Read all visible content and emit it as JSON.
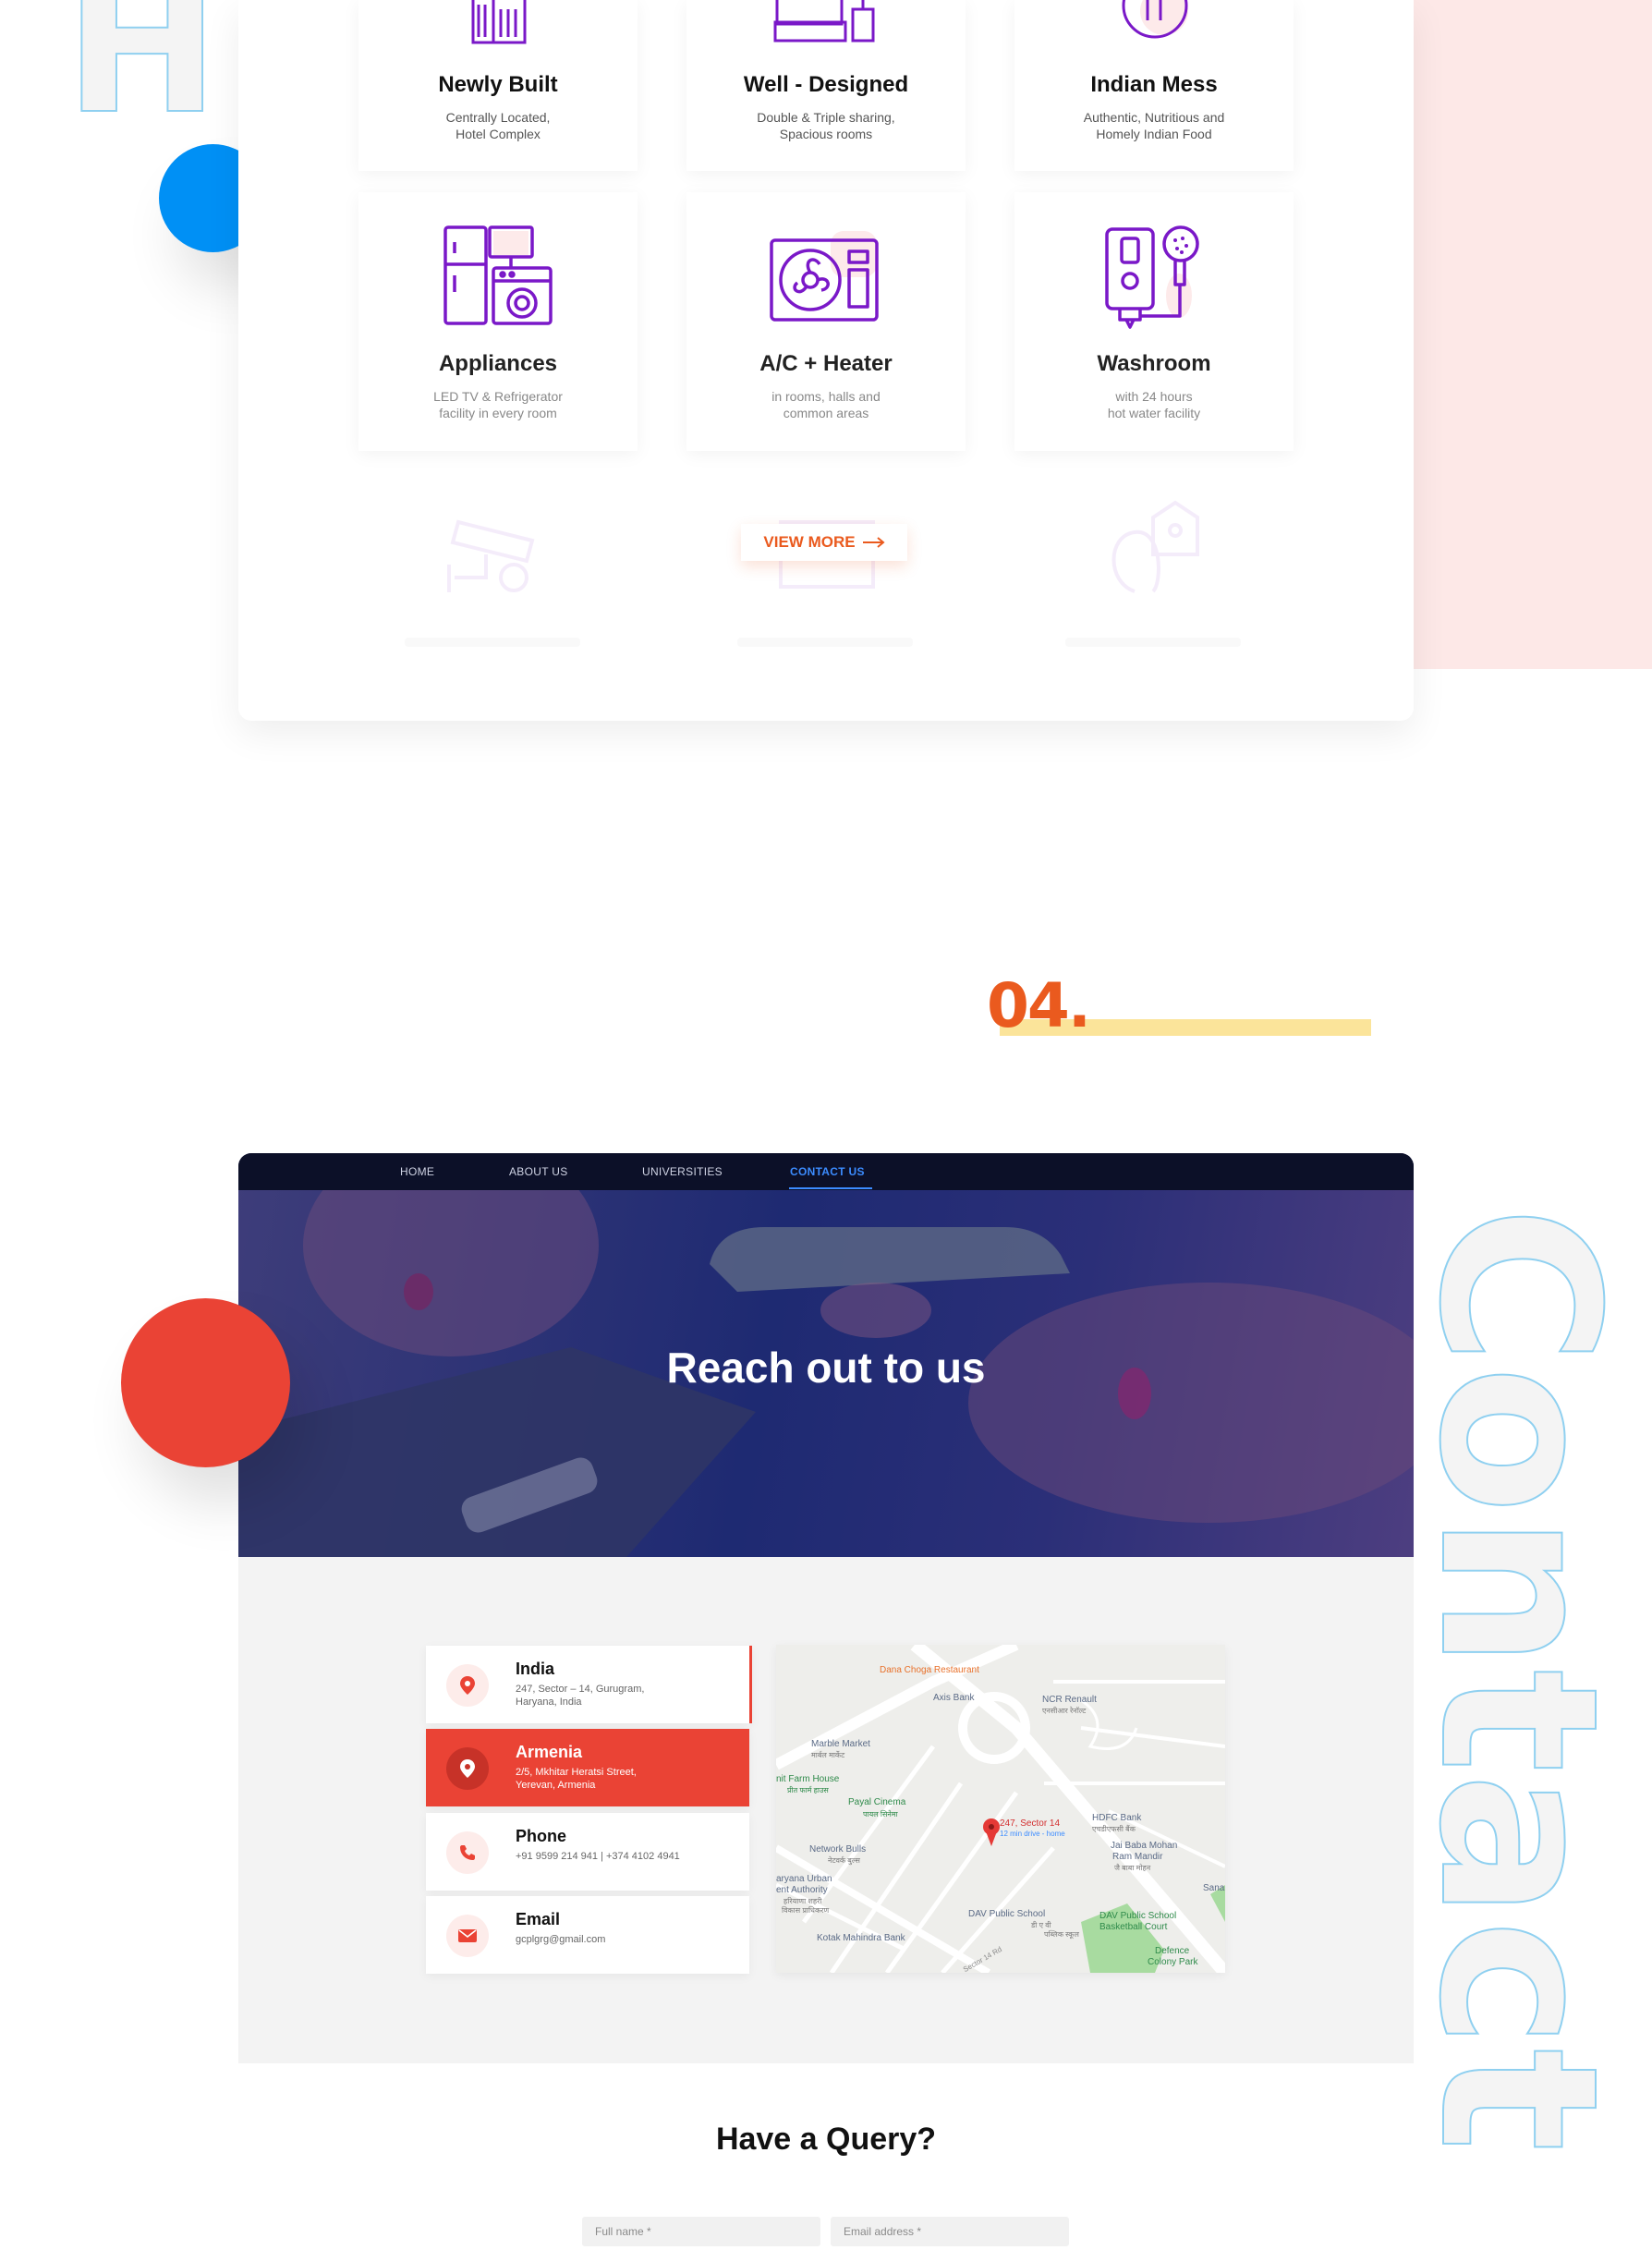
{
  "decor": {
    "letter_top": "H",
    "contact_word": [
      "C",
      "o",
      "n",
      "t",
      "a",
      "c",
      "t"
    ]
  },
  "amenities": [
    {
      "title": "Newly Built",
      "desc": "Centrally Located,\nHotel Complex",
      "icon": "building-icon"
    },
    {
      "title": "Well - Designed",
      "desc": "Double & Triple sharing,\nSpacious rooms",
      "icon": "bed-icon"
    },
    {
      "title": "Indian Mess",
      "desc": "Authentic, Nutritious and\nHomely Indian Food",
      "icon": "food-plate-icon"
    },
    {
      "title": "Appliances",
      "desc": "LED TV & Refrigerator\nfacility in every room",
      "icon": "appliances-icon"
    },
    {
      "title": "A/C + Heater",
      "desc": "in rooms, halls and\ncommon areas",
      "icon": "air-conditioner-icon"
    },
    {
      "title": "Washroom",
      "desc": "with 24 hours\nhot water facility",
      "icon": "water-heater-shower-icon"
    }
  ],
  "faded_icons": [
    "cctv-camera-icon",
    "bed-icon",
    "fingerprint-lock-icon"
  ],
  "view_more": {
    "label": "VIEW MORE"
  },
  "section_number": "04.",
  "nav": {
    "items": [
      "HOME",
      "ABOUT US",
      "UNIVERSITIES",
      "CONTACT US"
    ],
    "active": "CONTACT US"
  },
  "hero": {
    "title": "Reach out to us"
  },
  "contacts": [
    {
      "title": "India",
      "detail": "247, Sector – 14, Gurugram,\nHaryana, India",
      "icon": "location-pin-icon"
    },
    {
      "title": "Armenia",
      "detail": "2/5, Mkhitar Heratsi Street,\nYerevan, Armenia",
      "icon": "location-pin-icon"
    },
    {
      "title": "Phone",
      "detail": "+91 9599 214 941 | +374 4102 4941",
      "icon": "phone-icon"
    },
    {
      "title": "Email",
      "detail": "gcplgrg@gmail.com",
      "icon": "email-icon"
    }
  ],
  "map": {
    "labels": {
      "dana_choga": "Dana Choga Restaurant",
      "axis_bank": "Axis Bank",
      "ncr_renault": "NCR Renault",
      "ncr_renault_sub": "एनसीआर रेनॉल्ट",
      "marble_market": "Marble Market",
      "marble_market_sub": "मार्बल मार्केट",
      "farm_house": "nit Farm House",
      "farm_house_sub": "प्रीत फार्म हाउस",
      "payal_cinema": "Payal Cinema",
      "payal_cinema_sub": "पायल सिनेमा",
      "marker_title": "247, Sector 14",
      "marker_sub": "12 min drive - home",
      "hdfc": "HDFC Bank",
      "hdfc_sub": "एचडीएफसी बैंक",
      "jai_baba": "Jai Baba Mohan",
      "jai_baba2": "Ram Mandir",
      "jai_baba_sub": "जै बाबा मोहन",
      "network_bulls": "Network Bulls",
      "network_bulls_sub": "नेटवर्क बुल्स",
      "haryana_urban": "aryana Urban",
      "haryana_urban2": "ent Authority",
      "haryana_urban_sub": "हरियाणा शहरी",
      "haryana_urban_sub2": "विकास प्राधिकरण",
      "dav_school": "DAV Public School",
      "dav_school_sub": "डी ए वी",
      "dav_court": "DAV Public School",
      "dav_court2": "Basketball Court",
      "dav_court_sub": "पब्लिक स्कूल",
      "kotak": "Kotak Mahindra Bank",
      "defence": "Defence",
      "defence2": "Colony Park",
      "sana": "Sana",
      "road": "Sector 14 Rd"
    }
  },
  "query": {
    "title": "Have a Query?",
    "full_name_placeholder": "Full name *",
    "email_placeholder": "Email address *"
  }
}
